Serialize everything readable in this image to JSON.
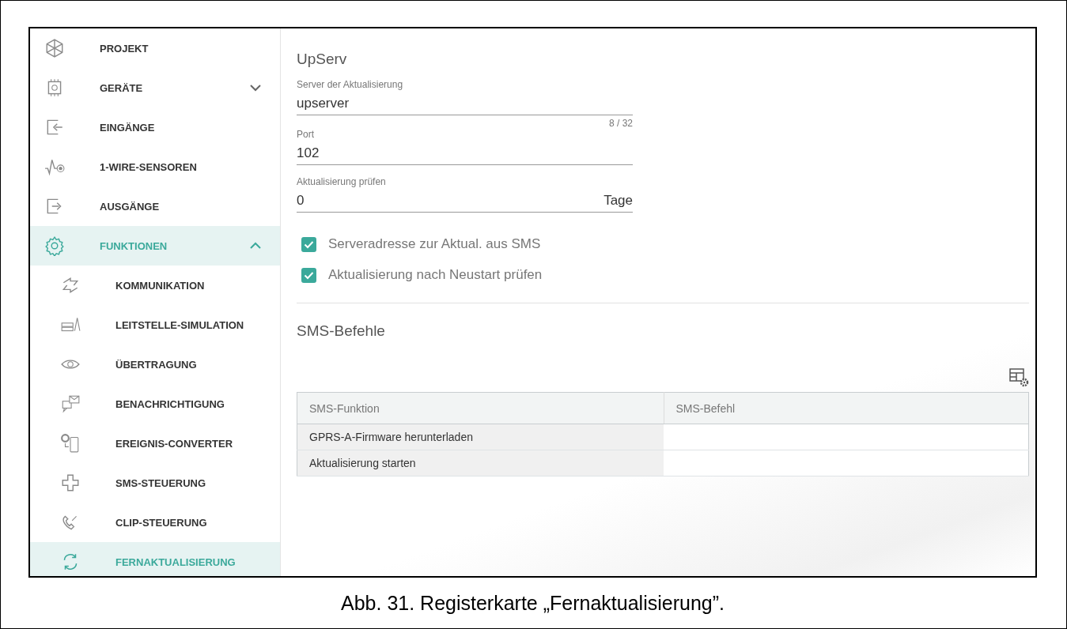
{
  "sidebar": {
    "items": [
      {
        "label": "PROJEKT",
        "selected": false
      },
      {
        "label": "GERÄTE",
        "selected": false,
        "expanded": false
      },
      {
        "label": "EINGÄNGE",
        "selected": false
      },
      {
        "label": "1-WIRE-SENSOREN",
        "selected": false
      },
      {
        "label": "AUSGÄNGE",
        "selected": false
      },
      {
        "label": "FUNKTIONEN",
        "selected": true,
        "expanded": true,
        "children": [
          {
            "label": "KOMMUNIKATION",
            "selected": false
          },
          {
            "label": "LEITSTELLE-SIMULATION",
            "selected": false
          },
          {
            "label": "ÜBERTRAGUNG",
            "selected": false
          },
          {
            "label": "BENACHRICHTIGUNG",
            "selected": false
          },
          {
            "label": "EREIGNIS-CONVERTER",
            "selected": false
          },
          {
            "label": "SMS-STEUERUNG",
            "selected": false
          },
          {
            "label": "CLIP-STEUERUNG",
            "selected": false
          },
          {
            "label": "FERNAKTUALISIERUNG",
            "selected": true
          }
        ]
      }
    ]
  },
  "upserv": {
    "title": "UpServ",
    "fields": [
      {
        "label": "Server der Aktualisierung",
        "value": "upserver",
        "counter": "8 / 32"
      },
      {
        "label": "Port",
        "value": "102"
      },
      {
        "label": "Aktualisierung prüfen",
        "value": "0",
        "suffix": "Tage"
      }
    ],
    "checkboxes": [
      {
        "label": "Serveradresse zur Aktual. aus SMS",
        "checked": true
      },
      {
        "label": "Aktualisierung nach Neustart prüfen",
        "checked": true
      }
    ]
  },
  "sms_commands": {
    "title": "SMS-Befehle",
    "table": {
      "columns": [
        "SMS-Funktion",
        "SMS-Befehl"
      ],
      "rows": [
        [
          "GPRS-A-Firmware herunterladen",
          ""
        ],
        [
          "Aktualisierung starten",
          ""
        ]
      ]
    }
  },
  "caption": "Abb. 31. Registerkarte „Fernaktualisierung”."
}
